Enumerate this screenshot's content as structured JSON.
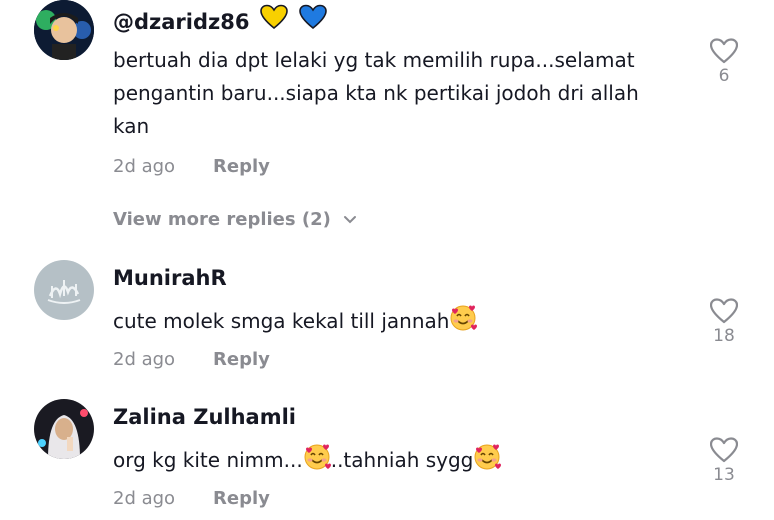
{
  "comments": [
    {
      "username": "@dzaridz86",
      "username_icons": [
        "yellow-heart-icon",
        "blue-heart-icon"
      ],
      "text": "bertuah dia dpt lelaki yg tak memilih rupa...selamat pengantin baru...siapa kta nk pertikai jodoh dri allah kan",
      "time": "2d ago",
      "reply_label": "Reply",
      "likes": "6"
    },
    {
      "username": "MunirahR",
      "text": "cute molek smga kekal till jannah",
      "text_emoji": "smiling-face-with-hearts-icon",
      "time": "2d ago",
      "reply_label": "Reply",
      "likes": "18"
    },
    {
      "username": "Zalina Zulhamli",
      "text_part1": "org kg kite nimm...",
      "text_part2": "..tahniah sygg",
      "text_emoji": "smiling-face-with-hearts-icon",
      "time": "2d ago",
      "reply_label": "Reply",
      "likes": "13"
    }
  ],
  "view_more_replies": "View more replies (2)",
  "colors": {
    "text": "#161823",
    "muted": "#8a8b91",
    "yellow_heart": "#f8d000",
    "blue_heart": "#1f7ae0"
  }
}
